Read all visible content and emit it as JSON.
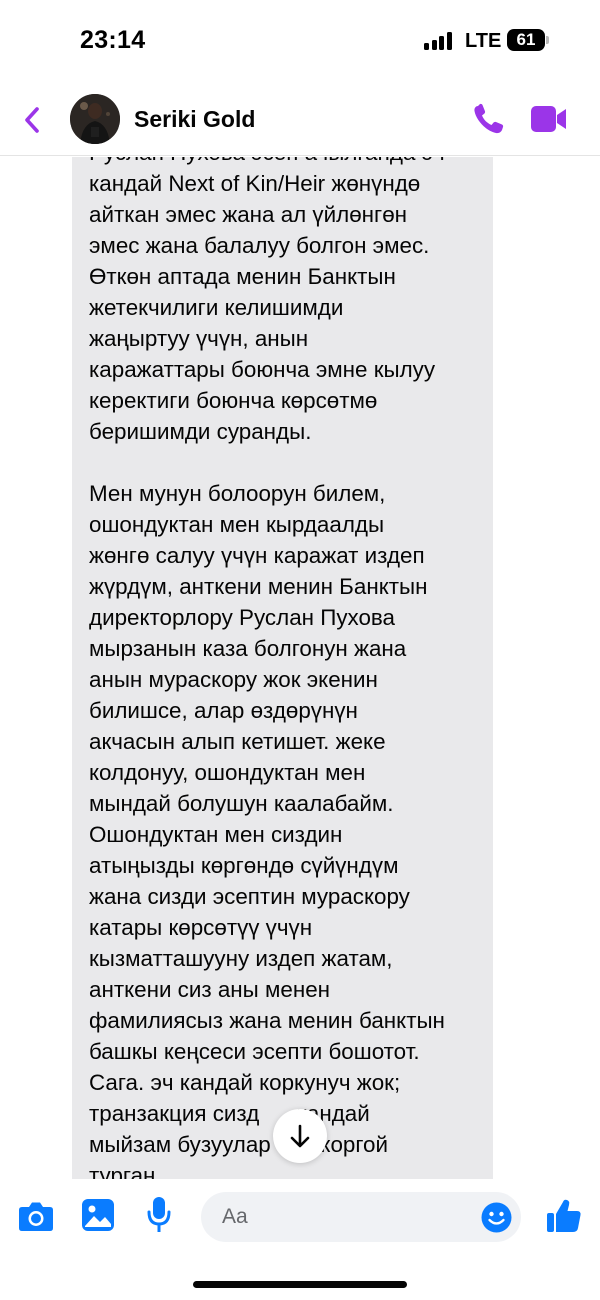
{
  "status_bar": {
    "time": "23:14",
    "network": "LTE",
    "battery": "61"
  },
  "header": {
    "contact_name": "Seriki Gold",
    "accent_color": "#9b35e8"
  },
  "message": {
    "lines": [
      "Руслан Пухова эсеп ачылганда эч",
      "кандай Next of Kin/Heir жөнүндө",
      "айткан эмес жана ал үйлөнгөн",
      "эмес жана балалуу болгон эмес.",
      "Өткөн аптада менин Банктын",
      "жетекчилиги келишимди",
      "жаңыртуу үчүн, анын",
      "каражаттары боюнча эмне кылуу",
      "керектиги боюнча көрсөтмө",
      "беришимди суранды.",
      "",
      "Мен мунун болоорун билем,",
      "ошондуктан мен кырдаалды",
      "жөнгө салуу үчүн каражат издеп",
      "жүрдүм, анткени менин Банктын",
      "директорлору Руслан Пухова",
      "мырзанын каза болгонун жана",
      "анын мураскору жок экенин",
      "билишсе, алар өздөрүнүн",
      "акчасын алып кетишет. жеке",
      "колдонуу, ошондуктан мен",
      "мындай болушун каалабайм.",
      "Ошондуктан мен сиздин",
      "атыңызды көргөндө сүйүндүм",
      "жана сизди эсептин мураскору",
      "катары көрсөтүү үчүн",
      "кызматташууну издеп жатам,",
      "анткени сиз аны менен",
      "фамилиясыз жана менин банктын",
      "башкы кеңсеси эсепти бошотот.",
      "Сага. эч кандай коркунуч жок;",
      "транзакция сизд      кандай",
      "мыйзам бузуулар     н коргой",
      "турган"
    ]
  },
  "composer": {
    "placeholder": "Aa"
  }
}
